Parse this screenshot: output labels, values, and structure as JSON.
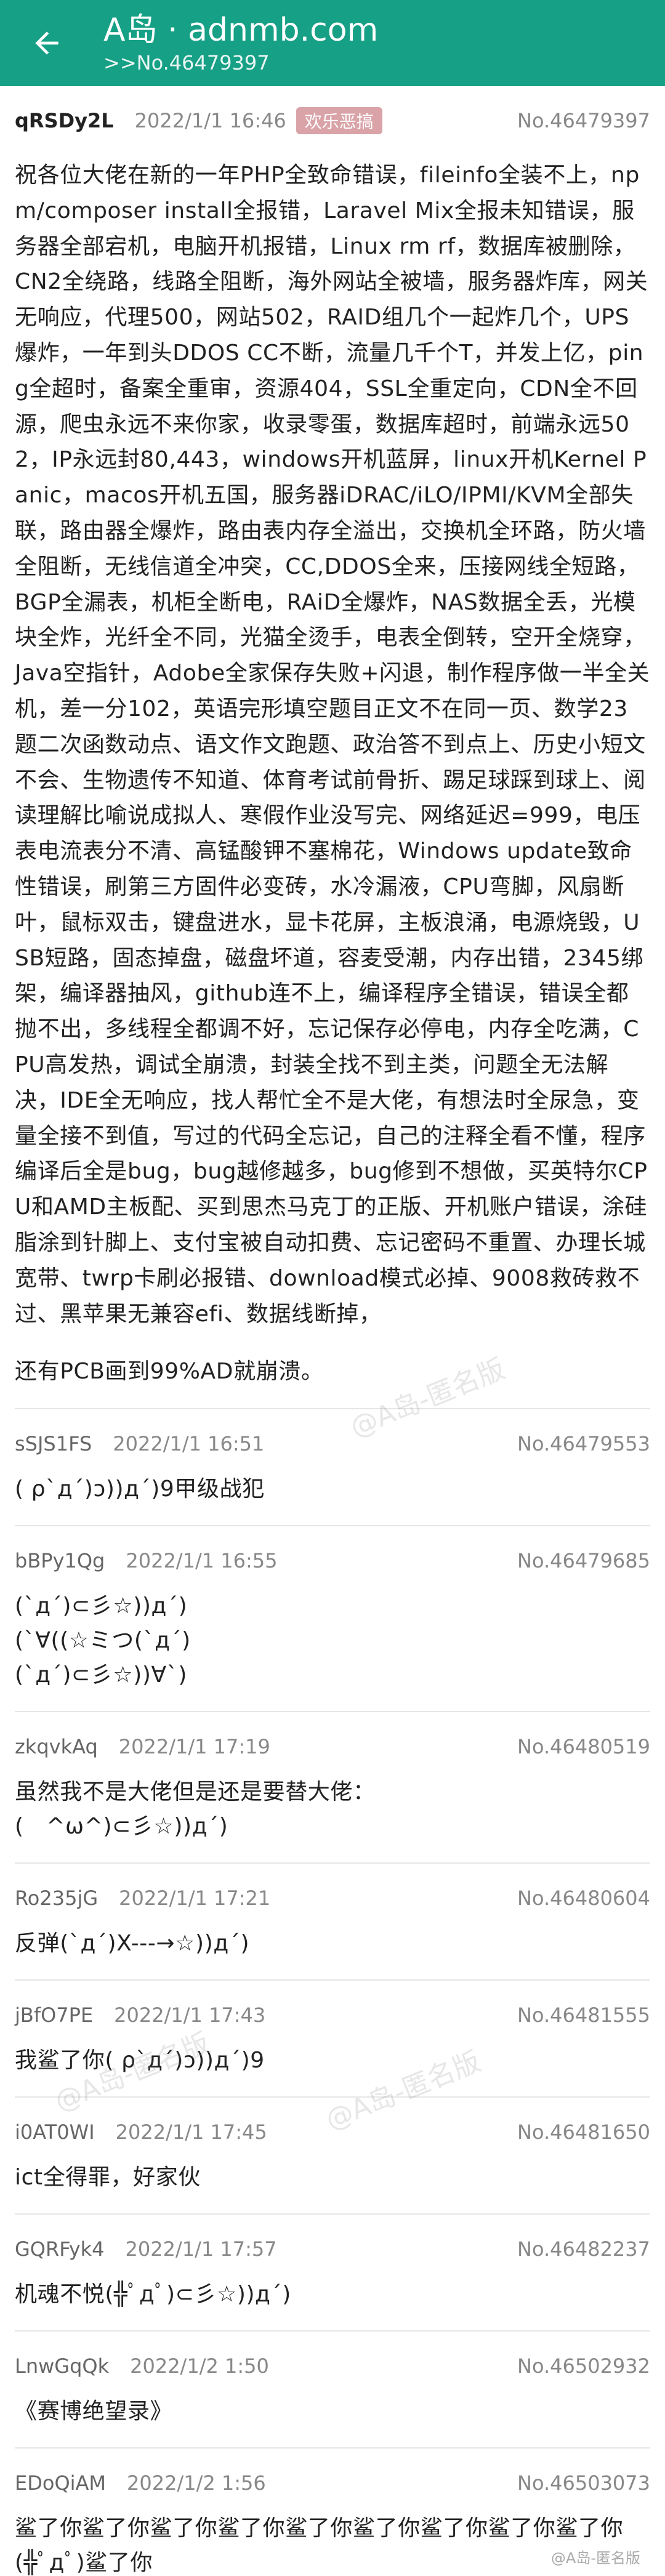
{
  "header": {
    "title": "A岛 · adnmb.com",
    "subtitle": ">>No.46479397"
  },
  "op": {
    "uid": "qRSDy2L",
    "time": "2022/1/1 16:46",
    "tag": "欢乐恶搞",
    "no": "No.46479397",
    "body": "祝各位大佬在新的一年PHP全致命错误，fileinfo全装不上，npm/composer install全报错，Laravel Mix全报未知错误，服务器全部宕机，电脑开机报错，Linux rm rf，数据库被删除，CN2全绕路，线路全阻断，海外网站全被墙，服务器炸库，网关无响应，代理500，网站502，RAID组几个一起炸几个，UPS爆炸，一年到头DDOS CC不断，流量几千个T，并发上亿，ping全超时，备案全重审，资源404，SSL全重定向，CDN全不回源，爬虫永远不来你家，收录零蛋，数据库超时，前端永远502，IP永远封80,443，windows开机蓝屏，linux开机Kernel Panic，macos开机五国，服务器iDRAC/iLO/IPMI/KVM全部失联，路由器全爆炸，路由表内存全溢出，交换机全环路，防火墙全阻断，无线信道全冲突，CC,DDOS全来，压接网线全短路，BGP全漏表，机柜全断电，RAiD全爆炸，NAS数据全丢，光模块全炸，光纤全不同，光猫全烫手，电表全倒转，空开全烧穿，Java空指针，Adobe全家保存失败+闪退，制作程序做一半全关机，差一分102，英语完形填空题目正文不在同一页、数学23题二次函数动点、语文作文跑题、政治答不到点上、历史小短文不会、生物遗传不知道、体育考试前骨折、踢足球踩到球上、阅读理解比喻说成拟人、寒假作业没写完、网络延迟=999，电压表电流表分不清、高锰酸钾不塞棉花，Windows update致命性错误，刷第三方固件必变砖，水冷漏液，CPU弯脚，风扇断叶，鼠标双击，键盘进水，显卡花屏，主板浪涌，电源烧毁，USB短路，固态掉盘，磁盘坏道，容麦受潮，内存出错，2345绑架，编译器抽风，github连不上，编译程序全错误，错误全都抛不出，多线程全都调不好，忘记保存必停电，内存全吃满，CPU高发热，调试全崩溃，封装全找不到主类，问题全无法解决，IDE全无响应，找人帮忙全不是大佬，有想法时全尿急，变量全接不到值，写过的代码全忘记，自己的注释全看不懂，程序编译后全是bug，bug越修越多，bug修到不想做，买英特尔CPU和AMD主板配、买到思杰马克丁的正版、开机账户错误，涂硅脂涂到针脚上、支付宝被自动扣费、忘记密码不重置、办理长城宽带、twrp卡刷必报错、download模式必掉、9008救砖救不过、黑苹果无兼容efi、数据线断掉，",
    "body2": "还有PCB画到99%AD就崩溃。"
  },
  "replies": [
    {
      "uid": "sSJS1FS",
      "time": "2022/1/1 16:51",
      "no": "No.46479553",
      "body": "( ρ`д´)ɔ))д´)9甲级战犯"
    },
    {
      "uid": "bBPy1Qg",
      "time": "2022/1/1 16:55",
      "no": "No.46479685",
      "body": "(`д´)⊂彡☆))д´)\n(`∀((☆ミつ(`д´)\n(`д´)⊂彡☆))∀`)"
    },
    {
      "uid": "zkqvkAq",
      "time": "2022/1/1 17:19",
      "no": "No.46480519",
      "body": "虽然我不是大佬但是还是要替大佬：\n(　^ω^)⊂彡☆))д´)"
    },
    {
      "uid": "Ro235jG",
      "time": "2022/1/1 17:21",
      "no": "No.46480604",
      "body": "反弹(`д´)X---→☆))д´)"
    },
    {
      "uid": "jBfO7PE",
      "time": "2022/1/1 17:43",
      "no": "No.46481555",
      "body": "我鲨了你( ρ`д´)ɔ))д´)9"
    },
    {
      "uid": "i0AT0WI",
      "time": "2022/1/1 17:45",
      "no": "No.46481650",
      "body": "ict全得罪，好家伙"
    },
    {
      "uid": "GQRFyk4",
      "time": "2022/1/1 17:57",
      "no": "No.46482237",
      "body": "机魂不悦(╬ﾟдﾟ)⊂彡☆))д´)"
    },
    {
      "uid": "LnwGqQk",
      "time": "2022/1/2 1:50",
      "no": "No.46502932",
      "body": "《赛博绝望录》"
    },
    {
      "uid": "EDoQiAM",
      "time": "2022/1/2 1:56",
      "no": "No.46503073",
      "body": "鲨了你鲨了你鲨了你鲨了你鲨了你鲨了你鲨了你鲨了你鲨了你(╬ﾟдﾟ)鲨了你"
    }
  ],
  "watermark": "@A岛-匿名版",
  "colors": {
    "appbar": "#16a085",
    "tag": "#d9a3a8"
  }
}
